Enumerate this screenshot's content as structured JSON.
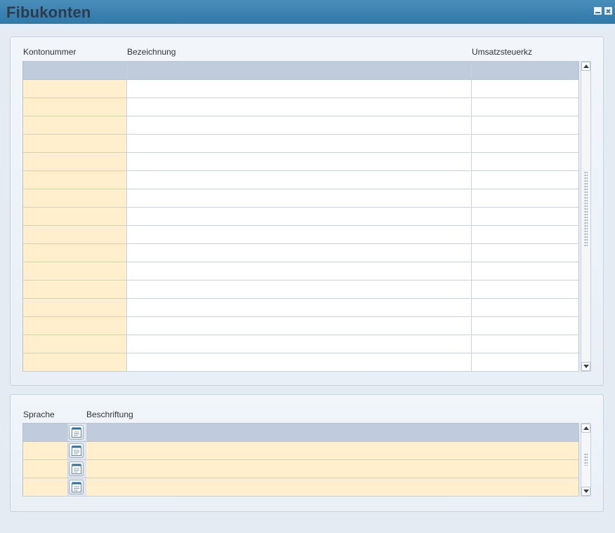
{
  "window": {
    "title": "Fibukonten",
    "minimize_icon": "minimize-icon",
    "close_icon": "close-icon"
  },
  "accounts_table": {
    "columns": [
      "Kontonummer",
      "Bezeichnung",
      "Umsatzsteuerkz"
    ],
    "rows": [
      {
        "kontonummer": "",
        "bezeichnung": "",
        "umsatzsteuerkz": ""
      },
      {
        "kontonummer": "",
        "bezeichnung": "",
        "umsatzsteuerkz": ""
      },
      {
        "kontonummer": "",
        "bezeichnung": "",
        "umsatzsteuerkz": ""
      },
      {
        "kontonummer": "",
        "bezeichnung": "",
        "umsatzsteuerkz": ""
      },
      {
        "kontonummer": "",
        "bezeichnung": "",
        "umsatzsteuerkz": ""
      },
      {
        "kontonummer": "",
        "bezeichnung": "",
        "umsatzsteuerkz": ""
      },
      {
        "kontonummer": "",
        "bezeichnung": "",
        "umsatzsteuerkz": ""
      },
      {
        "kontonummer": "",
        "bezeichnung": "",
        "umsatzsteuerkz": ""
      },
      {
        "kontonummer": "",
        "bezeichnung": "",
        "umsatzsteuerkz": ""
      },
      {
        "kontonummer": "",
        "bezeichnung": "",
        "umsatzsteuerkz": ""
      },
      {
        "kontonummer": "",
        "bezeichnung": "",
        "umsatzsteuerkz": ""
      },
      {
        "kontonummer": "",
        "bezeichnung": "",
        "umsatzsteuerkz": ""
      },
      {
        "kontonummer": "",
        "bezeichnung": "",
        "umsatzsteuerkz": ""
      },
      {
        "kontonummer": "",
        "bezeichnung": "",
        "umsatzsteuerkz": ""
      },
      {
        "kontonummer": "",
        "bezeichnung": "",
        "umsatzsteuerkz": ""
      },
      {
        "kontonummer": "",
        "bezeichnung": "",
        "umsatzsteuerkz": ""
      }
    ]
  },
  "labels_table": {
    "columns": [
      "Sprache",
      "Beschriftung"
    ],
    "row_icon": "note-icon",
    "rows": [
      {
        "sprache": "",
        "beschriftung": ""
      },
      {
        "sprache": "",
        "beschriftung": ""
      },
      {
        "sprache": "",
        "beschriftung": ""
      },
      {
        "sprache": "",
        "beschriftung": ""
      }
    ]
  },
  "colors": {
    "titlebar": "#2f78a8",
    "editable_cell": "#ffefcc",
    "header_row": "#c0ccdc"
  }
}
